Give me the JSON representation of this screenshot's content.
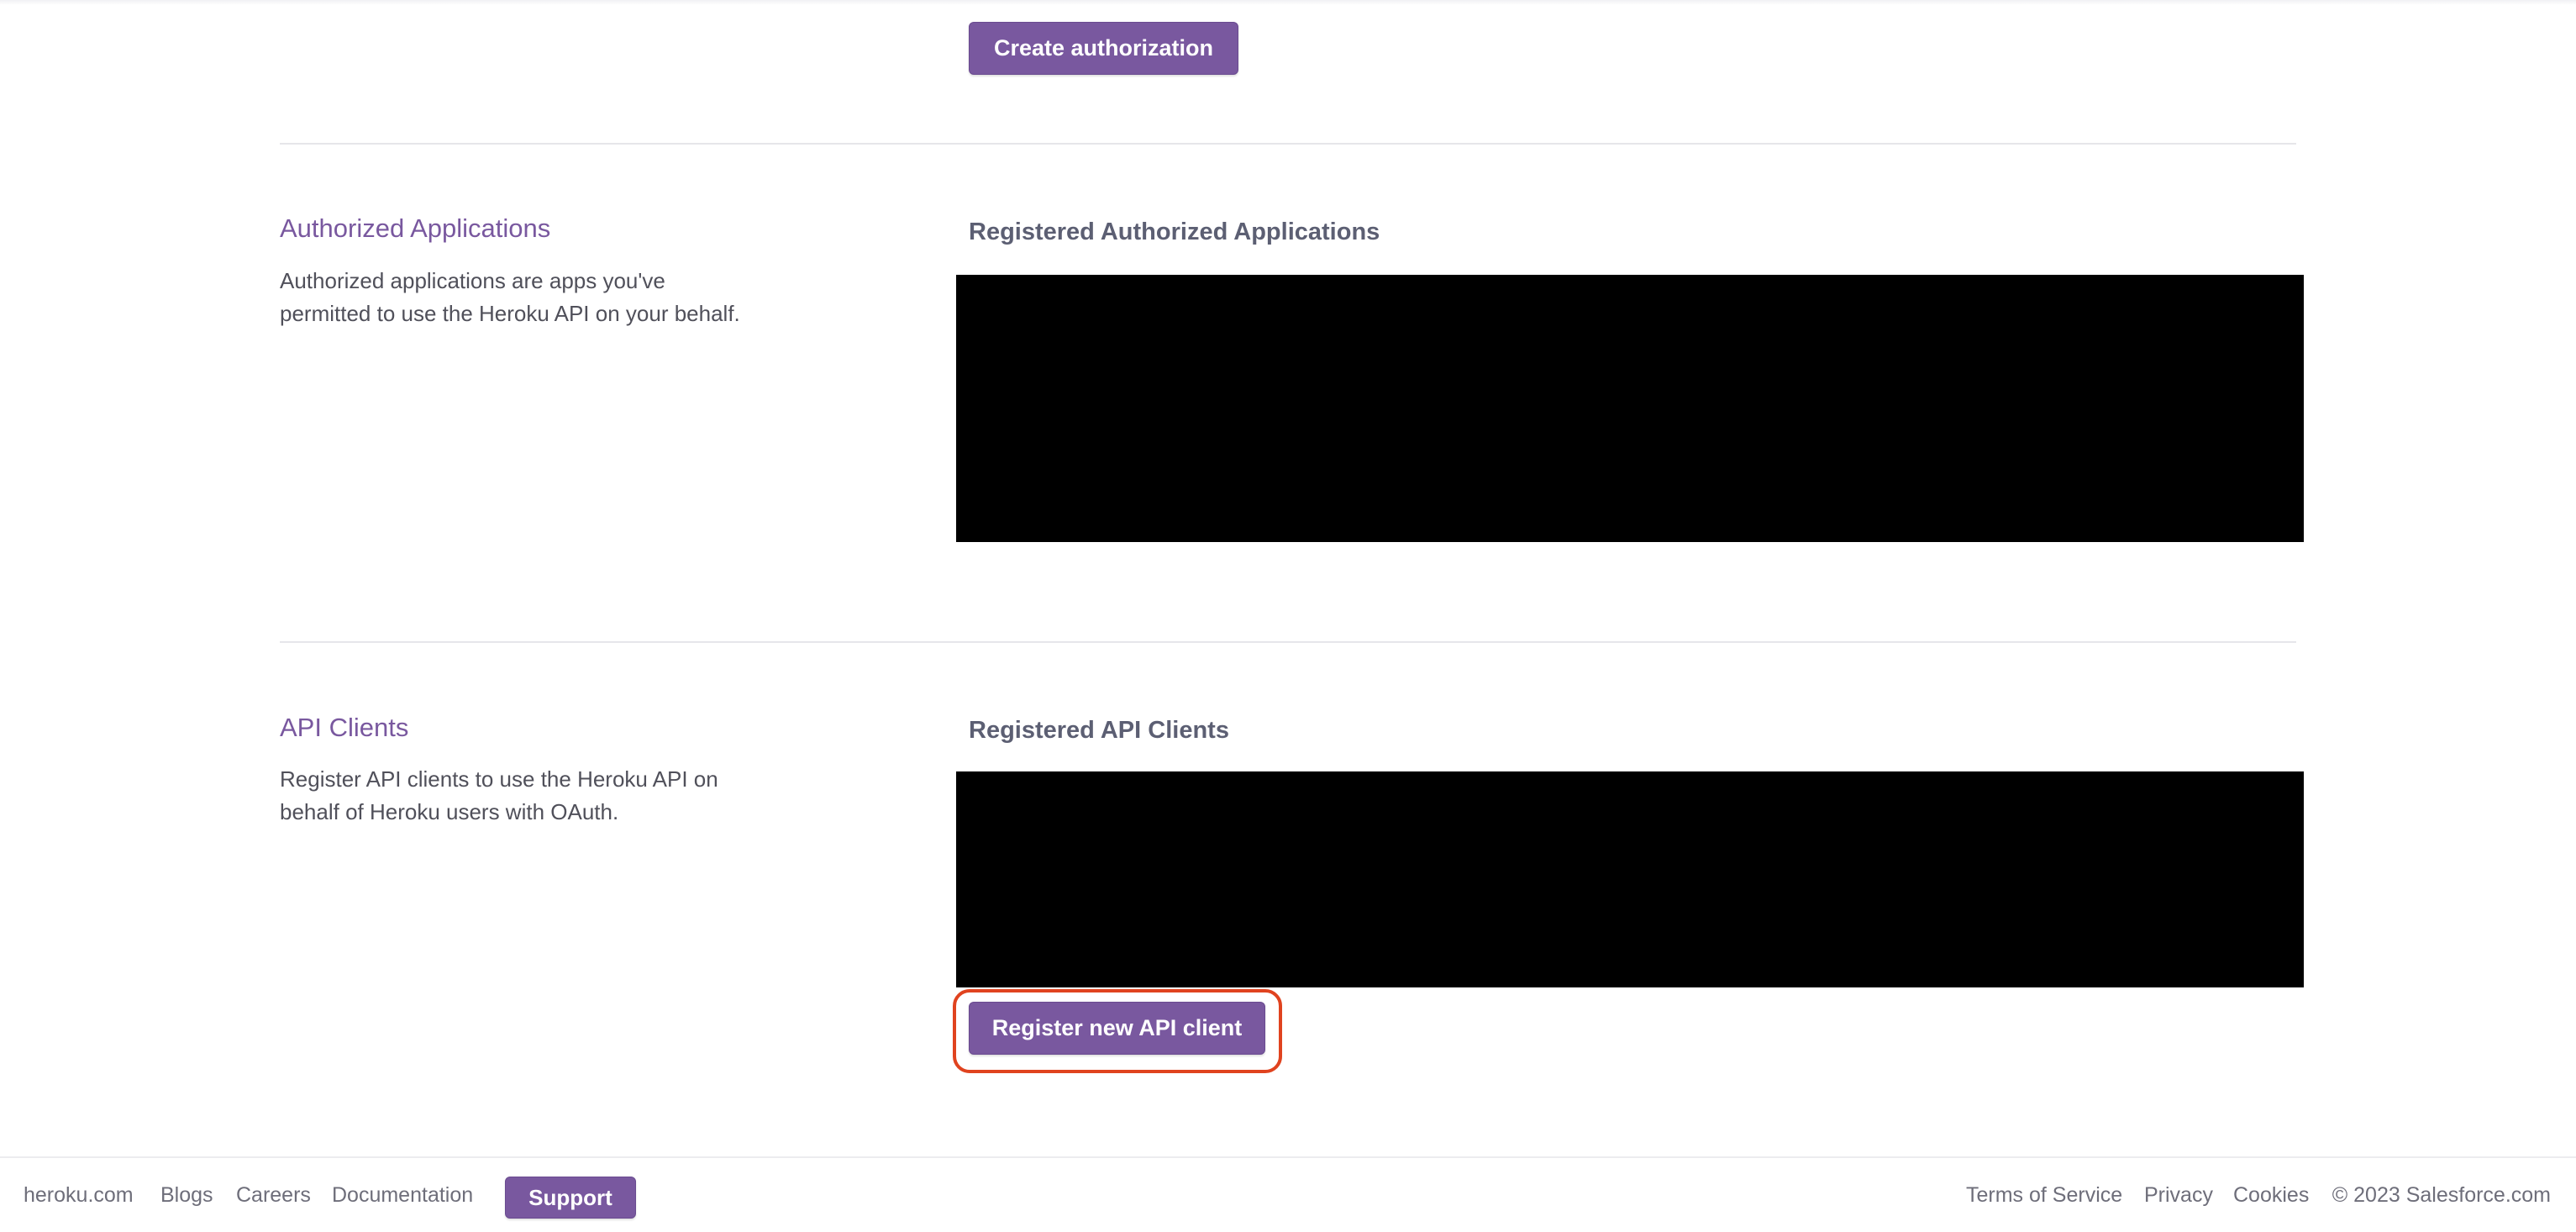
{
  "top": {
    "create_authorization_label": "Create authorization"
  },
  "authorized_applications": {
    "title": "Authorized Applications",
    "description": "Authorized applications are apps you've permitted to use the Heroku API on your behalf.",
    "panel_title": "Registered Authorized Applications"
  },
  "api_clients": {
    "title": "API Clients",
    "description": "Register API clients to use the Heroku API on behalf of Heroku users with OAuth.",
    "panel_title": "Registered API Clients",
    "register_label": "Register new API client"
  },
  "footer": {
    "links_left": [
      "heroku.com",
      "Blogs",
      "Careers",
      "Documentation"
    ],
    "support_label": "Support",
    "links_right": [
      "Terms of Service",
      "Privacy",
      "Cookies"
    ],
    "copyright": "© 2023 Salesforce.com"
  },
  "colors": {
    "accent": "#79589f",
    "highlight": "#e0431f",
    "redacted": "#000000"
  }
}
